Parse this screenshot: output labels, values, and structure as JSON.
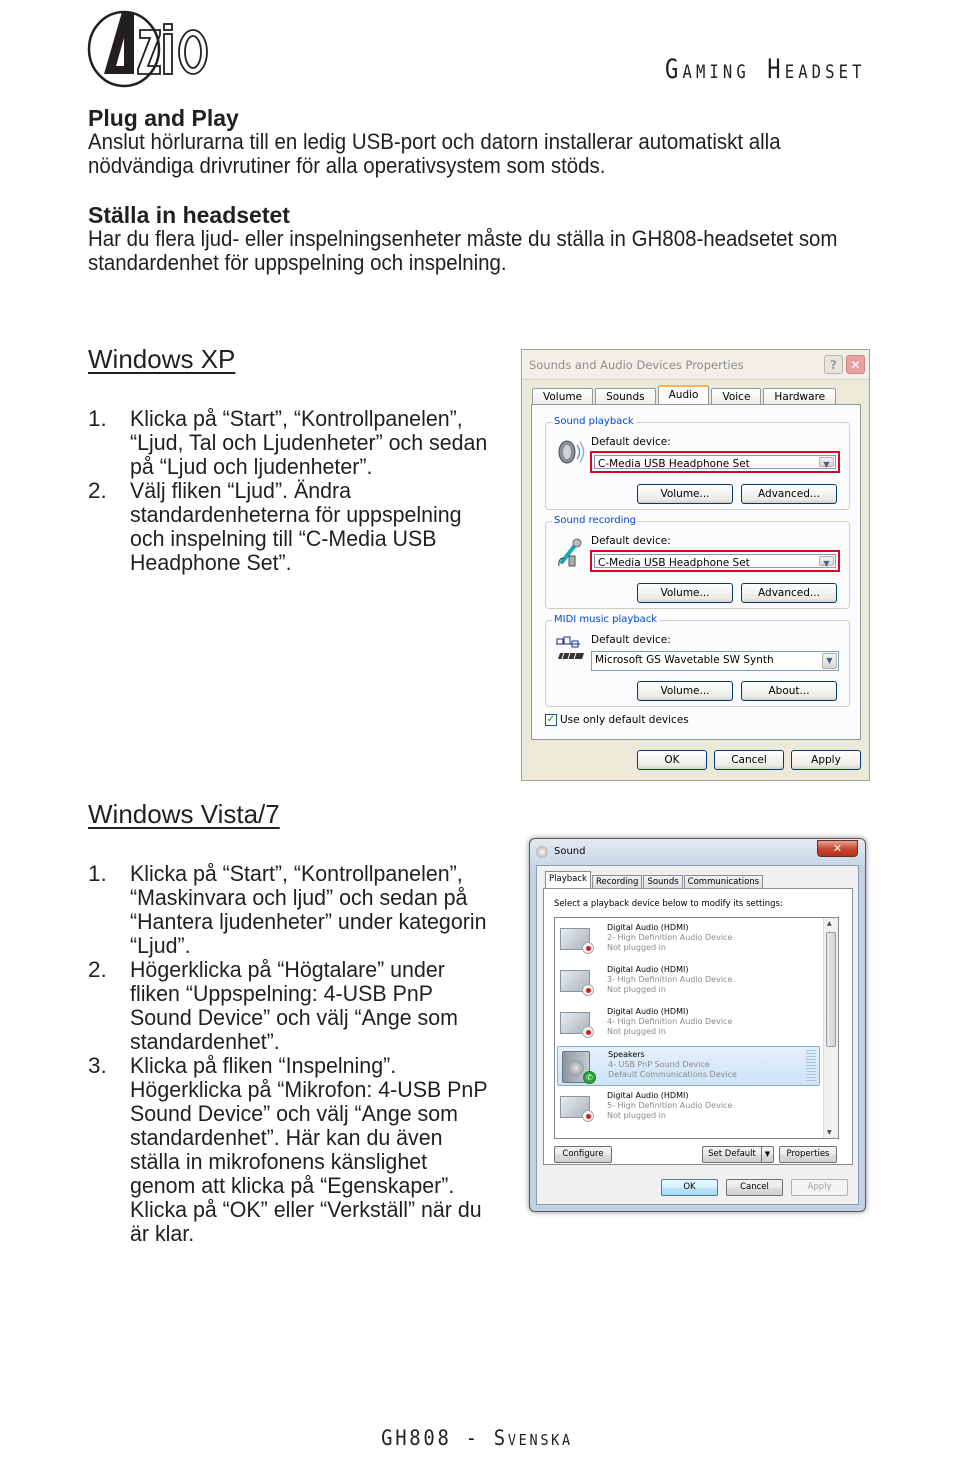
{
  "header": {
    "logo_text": "AZIO",
    "document_title": "Gaming Headset"
  },
  "sections": {
    "plug_and_play": {
      "title": "Plug and Play",
      "body": "Anslut hörlurarna till en ledig USB-port och datorn installerar automatiskt alla nödvändiga drivrutiner för alla operativsystem som stöds."
    },
    "setup": {
      "title": "Ställa in headsetet",
      "body": "Har du flera ljud- eller inspelningsenheter måste du ställa in GH808-headsetet som standardenhet för uppspelning och inspelning."
    }
  },
  "windows_xp": {
    "heading": "Windows XP",
    "steps": [
      {
        "num": "1.",
        "text": "Klicka på “Start”, “Kontrollpanelen”, “Ljud, Tal och Ljudenheter” och sedan på “Ljud och ljudenheter”."
      },
      {
        "num": "2.",
        "text": "Välj fliken “Ljud”. Ändra standardenheterna för uppspelning och inspelning till “C-Media USB Headphone Set”."
      }
    ],
    "dialog": {
      "title": "Sounds and Audio Devices Properties",
      "help_label": "?",
      "close_label": "✕",
      "tabs": [
        "Volume",
        "Sounds",
        "Audio",
        "Voice",
        "Hardware"
      ],
      "active_tab": "Audio",
      "groups": [
        {
          "label": "Sound playback",
          "icon": "speaker-icon",
          "default_label": "Default device:",
          "device": "C-Media USB Headphone Set",
          "highlighted": true,
          "buttons": [
            "Volume...",
            "Advanced..."
          ]
        },
        {
          "label": "Sound recording",
          "icon": "microphone-icon",
          "default_label": "Default device:",
          "device": "C-Media USB Headphone Set",
          "highlighted": true,
          "buttons": [
            "Volume...",
            "Advanced..."
          ]
        },
        {
          "label": "MIDI music playback",
          "icon": "midi-keyboard-icon",
          "default_label": "Default device:",
          "device": "Microsoft GS Wavetable SW Synth",
          "highlighted": false,
          "buttons": [
            "Volume...",
            "About..."
          ]
        }
      ],
      "checkbox": {
        "label": "Use only default devices",
        "checked": true
      },
      "footer_buttons": [
        "OK",
        "Cancel",
        "Apply"
      ]
    }
  },
  "windows_vista7": {
    "heading": "Windows Vista/7",
    "steps": [
      {
        "num": "1.",
        "text": "Klicka på “Start”, “Kontrollpanelen”, “Maskinvara och ljud” och sedan på “Hantera ljudenheter” under kategorin “Ljud”."
      },
      {
        "num": "2.",
        "text": "Högerklicka på “Högtalare” under fliken “Uppspelning: 4-USB PnP Sound Device” och välj “Ange som standardenhet”."
      },
      {
        "num": "3.",
        "text": "Klicka på fliken “Inspelning”. Högerklicka på “Mikrofon: 4-USB PnP Sound Device” och välj “Ange som standardenhet”. Här kan du även ställa in mikrofonens känslighet genom att klicka på “Egenskaper”. Klicka på “OK” eller “Verkställ” när du är klar."
      }
    ],
    "dialog": {
      "title": "Sound",
      "close_label": "✕",
      "tabs": [
        "Playback",
        "Recording",
        "Sounds",
        "Communications"
      ],
      "active_tab": "Playback",
      "instruction": "Select a playback device below to modify its settings:",
      "devices": [
        {
          "name": "Digital Audio (HDMI)",
          "driver": "2- High Definition Audio Device",
          "status": "Not plugged in",
          "type": "monitor",
          "selected": false
        },
        {
          "name": "Digital Audio (HDMI)",
          "driver": "3- High Definition Audio Device",
          "status": "Not plugged in",
          "type": "monitor",
          "selected": false
        },
        {
          "name": "Digital Audio (HDMI)",
          "driver": "4- High Definition Audio Device",
          "status": "Not plugged in",
          "type": "monitor",
          "selected": false
        },
        {
          "name": "Speakers",
          "driver": "4- USB PnP Sound Device",
          "status": "Default Communications Device",
          "type": "speaker",
          "selected": true
        },
        {
          "name": "Digital Audio (HDMI)",
          "driver": "5- High Definition Audio Device",
          "status": "Not plugged in",
          "type": "monitor",
          "selected": false
        }
      ],
      "buttons": {
        "configure": "Configure",
        "set_default": "Set Default",
        "properties": "Properties",
        "ok": "OK",
        "cancel": "Cancel",
        "apply": "Apply"
      }
    }
  },
  "footer": {
    "text": "GH808 - Svenska"
  }
}
